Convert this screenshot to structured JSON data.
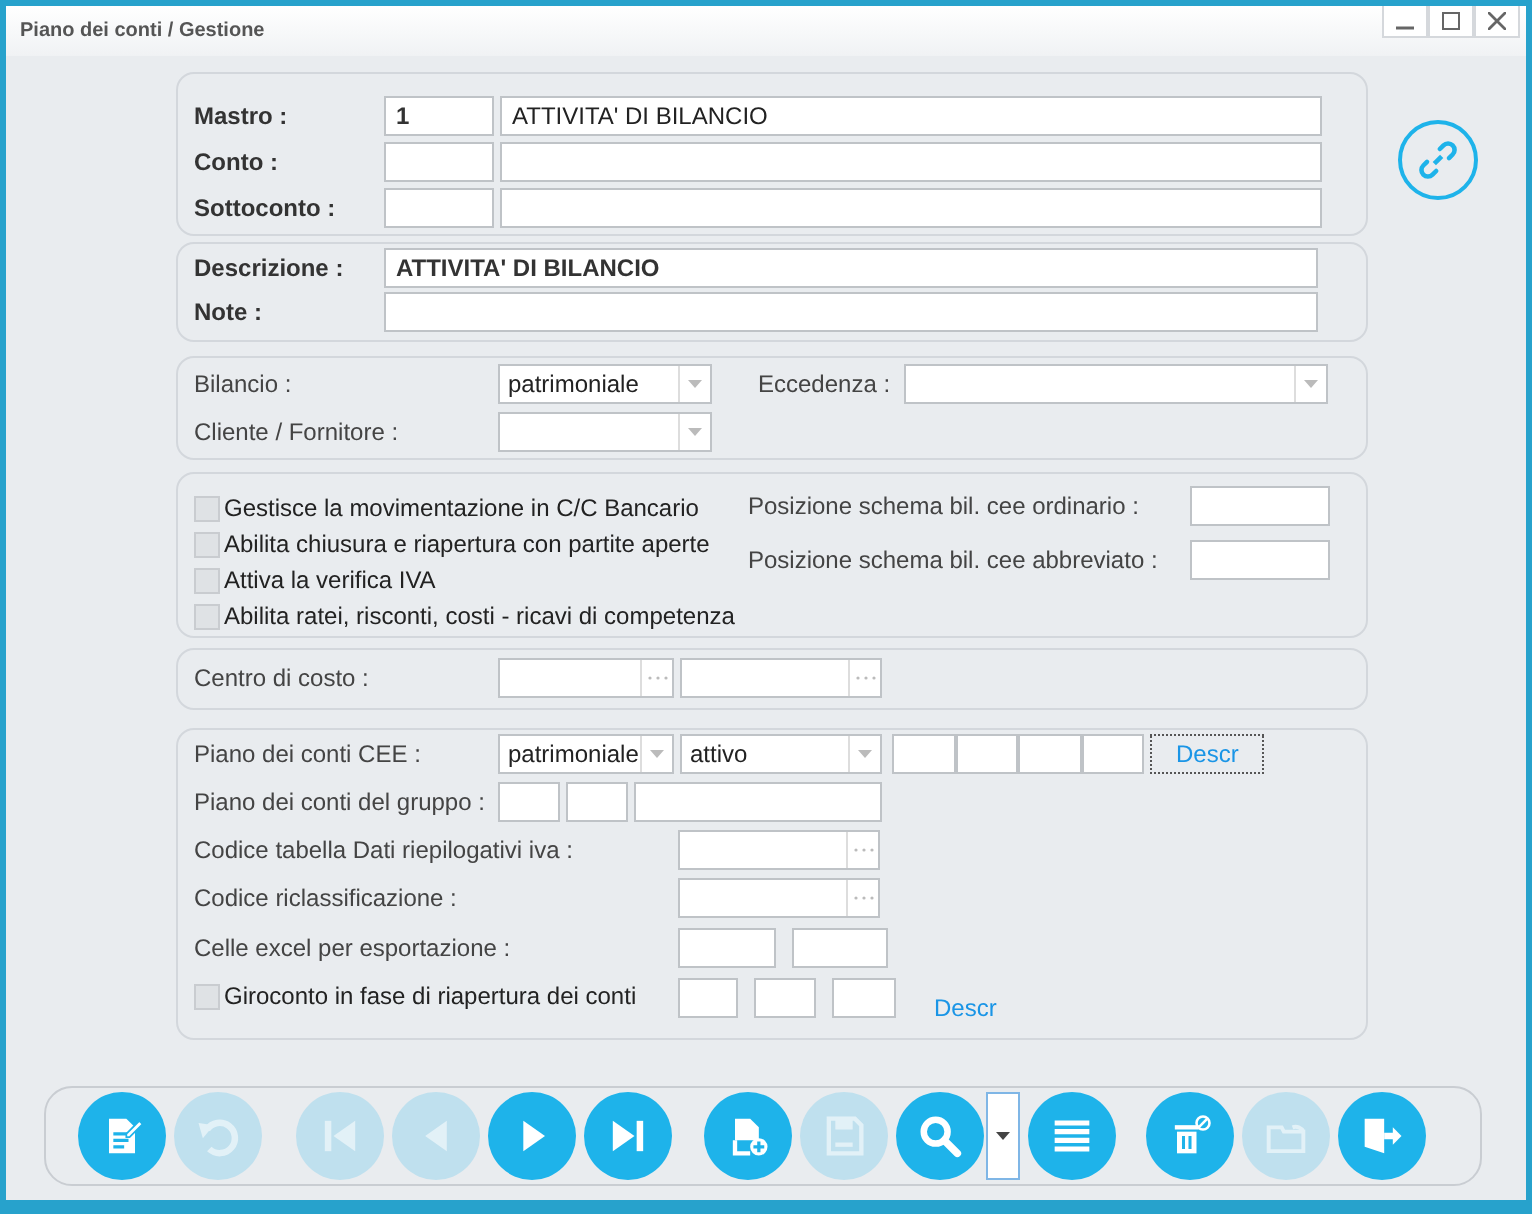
{
  "window": {
    "title": "Piano dei conti / Gestione"
  },
  "account": [
    {
      "label": "Mastro :",
      "code": "1",
      "name": "ATTIVITA' DI BILANCIO"
    },
    {
      "label": "Conto :"
    },
    {
      "label": "Sottoconto :"
    }
  ],
  "description": [
    {
      "label": "Descrizione :",
      "value": "ATTIVITA' DI BILANCIO"
    },
    {
      "label": "Note :"
    }
  ],
  "bilancio": {
    "label": "Bilancio :",
    "value": "patrimoniale"
  },
  "eccedenza": {
    "label": "Eccedenza :"
  },
  "cliente_fornitore": {
    "label": "Cliente / Fornitore :"
  },
  "options": [
    {
      "label": "Gestisce la movimentazione in C/C Bancario",
      "checked": false,
      "disabled": true
    },
    {
      "label": "Abilita chiusura e riapertura con partite aperte",
      "checked": false,
      "disabled": true
    },
    {
      "label": "Attiva la verifica IVA",
      "checked": false,
      "disabled": true
    },
    {
      "label": "Abilita ratei, risconti, costi - ricavi di competenza",
      "checked": false,
      "disabled": true
    }
  ],
  "positions": [
    {
      "label": "Posizione schema bil. cee ordinario :"
    },
    {
      "label": "Posizione schema bil. cee abbreviato :"
    }
  ],
  "centro_di_costo": {
    "label": "Centro di costo :"
  },
  "cee": {
    "label": "Piano dei conti CEE :",
    "section": "patrimoniale",
    "side": "attivo",
    "button": "Descr"
  },
  "gruppo": {
    "label": "Piano dei conti del gruppo :"
  },
  "codice_tabella": {
    "label": "Codice tabella Dati riepilogativi iva :"
  },
  "codice_riclassificazione": {
    "label": "Codice riclassificazione :"
  },
  "celle_excel": {
    "label": "Celle excel per esportazione :"
  },
  "giroconto": {
    "label": "Giroconto in fase di riapertura dei conti",
    "checked": false,
    "disabled": true,
    "link": "Descr"
  },
  "toolbar": [
    {
      "kind": "edit",
      "disabled": false
    },
    {
      "kind": "undo",
      "disabled": true
    },
    {
      "kind": "first",
      "disabled": true
    },
    {
      "kind": "prev",
      "disabled": true
    },
    {
      "kind": "next",
      "disabled": false
    },
    {
      "kind": "last",
      "disabled": false
    },
    {
      "kind": "new",
      "disabled": false
    },
    {
      "kind": "save",
      "disabled": true
    },
    {
      "kind": "search",
      "disabled": false
    },
    {
      "kind": "menu",
      "disabled": false
    },
    {
      "kind": "list",
      "disabled": false
    },
    {
      "kind": "delete",
      "disabled": false
    },
    {
      "kind": "folder",
      "disabled": true
    },
    {
      "kind": "exit",
      "disabled": false
    }
  ]
}
